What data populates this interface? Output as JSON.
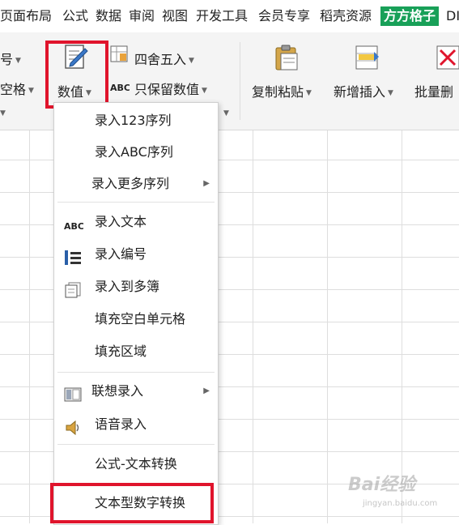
{
  "tabs": [
    "页面布局",
    "公式",
    "数据",
    "审阅",
    "视图",
    "开发工具",
    "会员专享",
    "稻壳资源",
    "方方格子",
    "DI"
  ],
  "active_tab_index": 8,
  "ribbon": {
    "left_partial_1": "号",
    "left_partial_2": "空格",
    "numeric_button": "数值",
    "round_button": "四舍五入",
    "keep_values_button": "只保留数值",
    "copy_paste_button": "复制粘贴",
    "new_insert_button": "新增插入",
    "batch_delete_button": "批量删"
  },
  "menu": {
    "items": [
      {
        "label": "录入123序列"
      },
      {
        "label": "录入ABC序列"
      },
      {
        "label": "录入更多序列",
        "submenu": true
      },
      {
        "label": "录入文本",
        "icon": "abc-text-icon"
      },
      {
        "label": "录入编号",
        "icon": "numbered-list-icon"
      },
      {
        "label": "录入到多簿",
        "icon": "documents-icon"
      },
      {
        "label": "填充空白单元格"
      },
      {
        "label": "填充区域"
      },
      {
        "label": "联想录入",
        "icon": "panel-icon",
        "submenu": true
      },
      {
        "label": "语音录入",
        "icon": "speaker-icon"
      },
      {
        "label": "公式-文本转换"
      },
      {
        "label": "文本型数字转换"
      }
    ]
  },
  "colors": {
    "accent_green": "#18a058",
    "highlight_red": "#e0142c"
  },
  "watermark": {
    "brand": "Bai经验",
    "url": "jingyan.baidu.com"
  }
}
